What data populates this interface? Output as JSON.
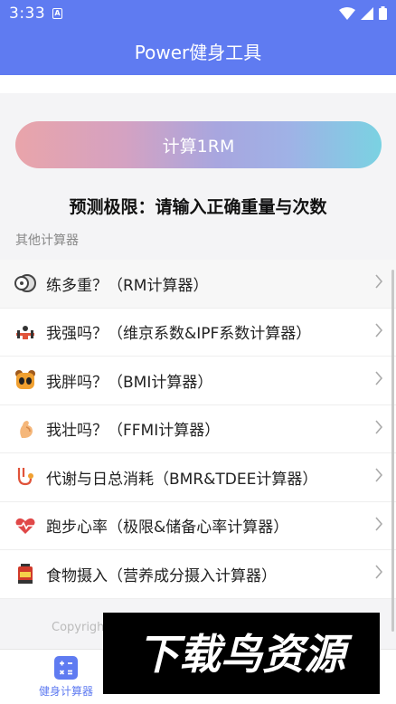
{
  "status_bar": {
    "time": "3:33",
    "notif_badge": "A"
  },
  "app_bar": {
    "title": "Power健身工具"
  },
  "calculator": {
    "button_label": "计算1RM",
    "predict_text": "预测极限：请输入正确重量与次数"
  },
  "section": {
    "title": "其他计算器"
  },
  "calculators": [
    {
      "label": "练多重？（RM计算器）",
      "icon": "dumbbell-plate-icon"
    },
    {
      "label": "我强吗？（维京系数&IPF系数计算器）",
      "icon": "barbell-icon"
    },
    {
      "label": "我胖吗？（BMI计算器）",
      "icon": "bear-icon"
    },
    {
      "label": "我壮吗？（FFMI计算器）",
      "icon": "muscle-arm-icon"
    },
    {
      "label": "代谢与日总消耗（BMR&TDEE计算器）",
      "icon": "stethoscope-icon"
    },
    {
      "label": "跑步心率（极限&储备心率计算器）",
      "icon": "heartbeat-icon"
    },
    {
      "label": "食物摄入（营养成分摄入计算器）",
      "icon": "food-jar-icon"
    }
  ],
  "footer": {
    "copyright": "Copyrigh"
  },
  "bottom_nav": {
    "items": [
      {
        "label": "健身计算器",
        "icon": "calculator-icon",
        "active": true
      }
    ]
  },
  "watermark": {
    "text": "下载鸟资源"
  },
  "colors": {
    "primary": "#5f7bf1",
    "text": "#222222",
    "muted": "#888888"
  }
}
